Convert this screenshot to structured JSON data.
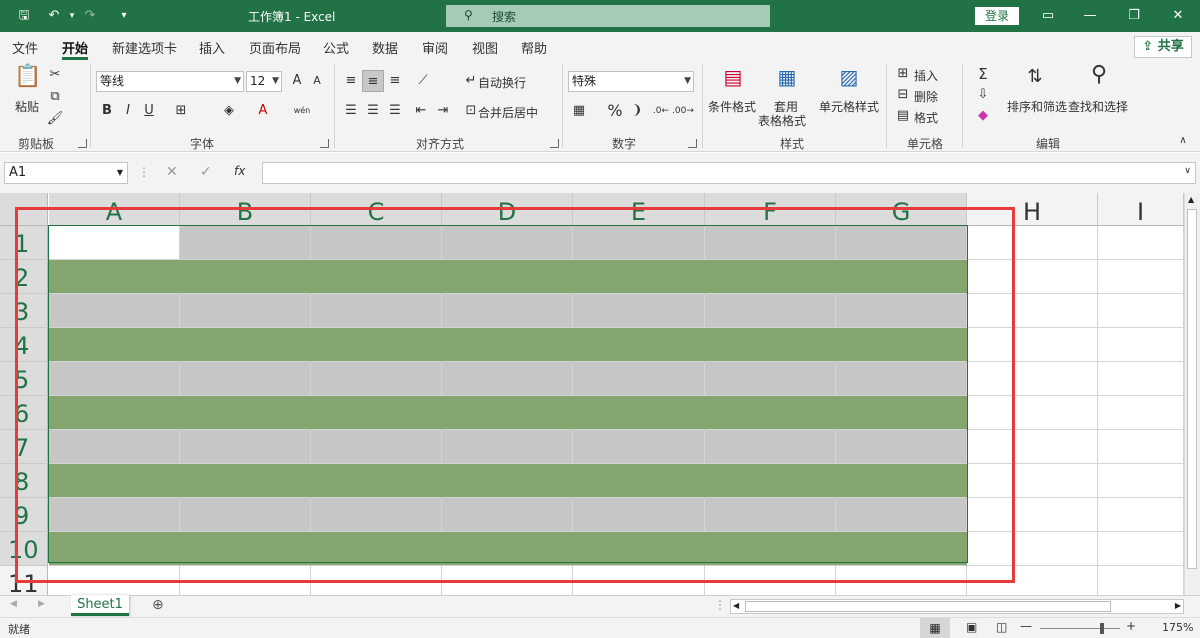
{
  "window": {
    "title": "工作簿1 - Excel",
    "search_placeholder": "搜索",
    "login": "登录",
    "share": "共享"
  },
  "tabs": [
    "文件",
    "开始",
    "新建选项卡",
    "插入",
    "页面布局",
    "公式",
    "数据",
    "审阅",
    "视图",
    "帮助"
  ],
  "active_tab": "开始",
  "ribbon": {
    "clipboard": {
      "paste": "粘贴",
      "group": "剪贴板"
    },
    "font": {
      "name": "等线",
      "size": "12",
      "bold": "B",
      "italic": "I",
      "underline": "U",
      "grow": "A",
      "shrink": "A",
      "color_a": "A",
      "phonetic": "wén",
      "group": "字体"
    },
    "alignment": {
      "wrap": "自动换行",
      "merge": "合并后居中",
      "group": "对齐方式"
    },
    "number": {
      "format": "特殊",
      "percent": "%",
      "comma": "❩",
      "group": "数字"
    },
    "styles": {
      "conditional": "条件格式",
      "table_line1": "套用",
      "table_line2": "表格格式",
      "cell_styles": "单元格样式",
      "group": "样式"
    },
    "cells": {
      "insert": "插入",
      "delete": "删除",
      "format": "格式",
      "group": "单元格"
    },
    "editing": {
      "sort": "排序和筛选",
      "find": "查找和选择",
      "group": "编辑"
    }
  },
  "formula_bar": {
    "name_box": "A1",
    "fx": "fx",
    "value": ""
  },
  "grid": {
    "columns": [
      "A",
      "B",
      "C",
      "D",
      "E",
      "F",
      "G",
      "H",
      "I"
    ],
    "rows": [
      "1",
      "2",
      "3",
      "4",
      "5",
      "6",
      "7",
      "8",
      "9",
      "10",
      "11"
    ],
    "band_colors": {
      "odd": "#c6c6c6",
      "even": "#84a56d"
    },
    "highlight_color": "#e63b3b"
  },
  "sheets": [
    "Sheet1"
  ],
  "status": {
    "ready": "就绪",
    "zoom": "175%"
  },
  "colors": {
    "accent": "#217346"
  }
}
